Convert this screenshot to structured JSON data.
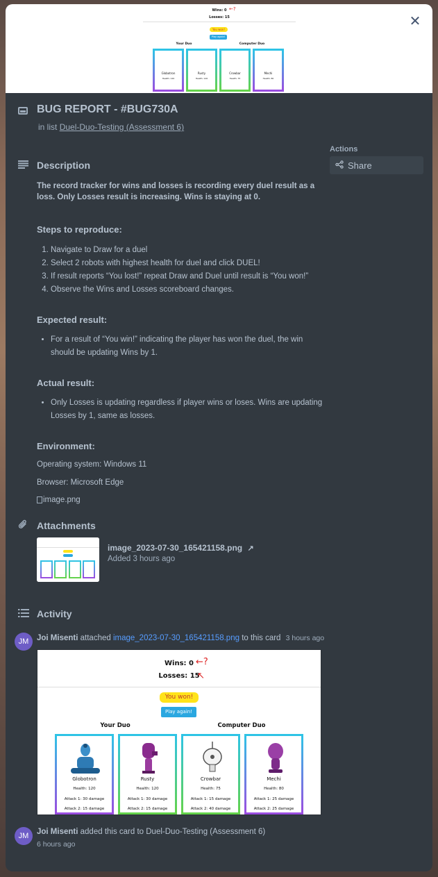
{
  "card": {
    "title": "BUG REPORT - #BUG730A",
    "in_list_prefix": "in list",
    "list_name": "Duel-Duo-Testing (Assessment 6)"
  },
  "actions": {
    "label": "Actions",
    "share": "Share"
  },
  "screenshot": {
    "wins": "Wins: 0",
    "losses": "Losses: 15",
    "question": "?",
    "result": "You won!",
    "play_again": "Play again!",
    "your_duo": "Your Duo",
    "computer_duo": "Computer Duo",
    "cards": [
      {
        "name": "Globotron",
        "health": "Health: 120",
        "attack1": "Attack 1: 30 damage",
        "attack2": "Attack 2: 15 damage"
      },
      {
        "name": "Rusty",
        "health": "Health: 120",
        "attack1": "Attack 1: 30 damage",
        "attack2": "Attack 2: 15 damage"
      },
      {
        "name": "Crowbar",
        "health": "Health: 75",
        "attack1": "Attack 1: 15 damage",
        "attack2": "Attack 2: 40 damage"
      },
      {
        "name": "Mechi",
        "health": "Health: 80",
        "attack1": "Attack 1: 25 damage",
        "attack2": "Attack 2: 25 damage"
      }
    ]
  },
  "description": {
    "heading": "Description",
    "summary": "The record tracker for wins and losses is recording every duel result as a loss. Only Losses result is increasing. Wins is staying at 0.",
    "steps_heading": "Steps to reproduce:",
    "steps": [
      "Navigate to Draw for a duel",
      "Select 2 robots with highest health for duel and click DUEL!",
      "If result reports “You lost!” repeat Draw and Duel until result is “You won!”",
      "Observe the Wins and Losses scoreboard changes."
    ],
    "expected_heading": "Expected result:",
    "expected": "For a result of “You win!” indicating the player has won the duel, the win should be updating Wins by 1.",
    "actual_heading": "Actual result:",
    "actual": "Only Losses is updating regardless if player wins or loses. Wins are updating Losses by 1, same as losses.",
    "environment_heading": "Environment:",
    "os": "Operating system: Windows 11",
    "browser": "Browser: Microsoft Edge",
    "image_alt": "image.png"
  },
  "attachments": {
    "heading": "Attachments",
    "file_name": "image_2023-07-30_165421158.png",
    "added": "Added 3 hours ago"
  },
  "activity": {
    "heading": "Activity",
    "items": [
      {
        "initials": "JM",
        "user": "Joi Misenti",
        "action": "attached",
        "link": "image_2023-07-30_165421158.png",
        "suffix": "to this card",
        "time": "3 hours ago"
      },
      {
        "initials": "JM",
        "user": "Joi Misenti",
        "action": "added this card to Duel-Duo-Testing (Assessment 6)",
        "time": "6 hours ago"
      }
    ]
  },
  "colors": {
    "modal_bg": "#323940",
    "text": "#b6c2cf",
    "link": "#579dff",
    "avatar": "#6e5dc6"
  }
}
